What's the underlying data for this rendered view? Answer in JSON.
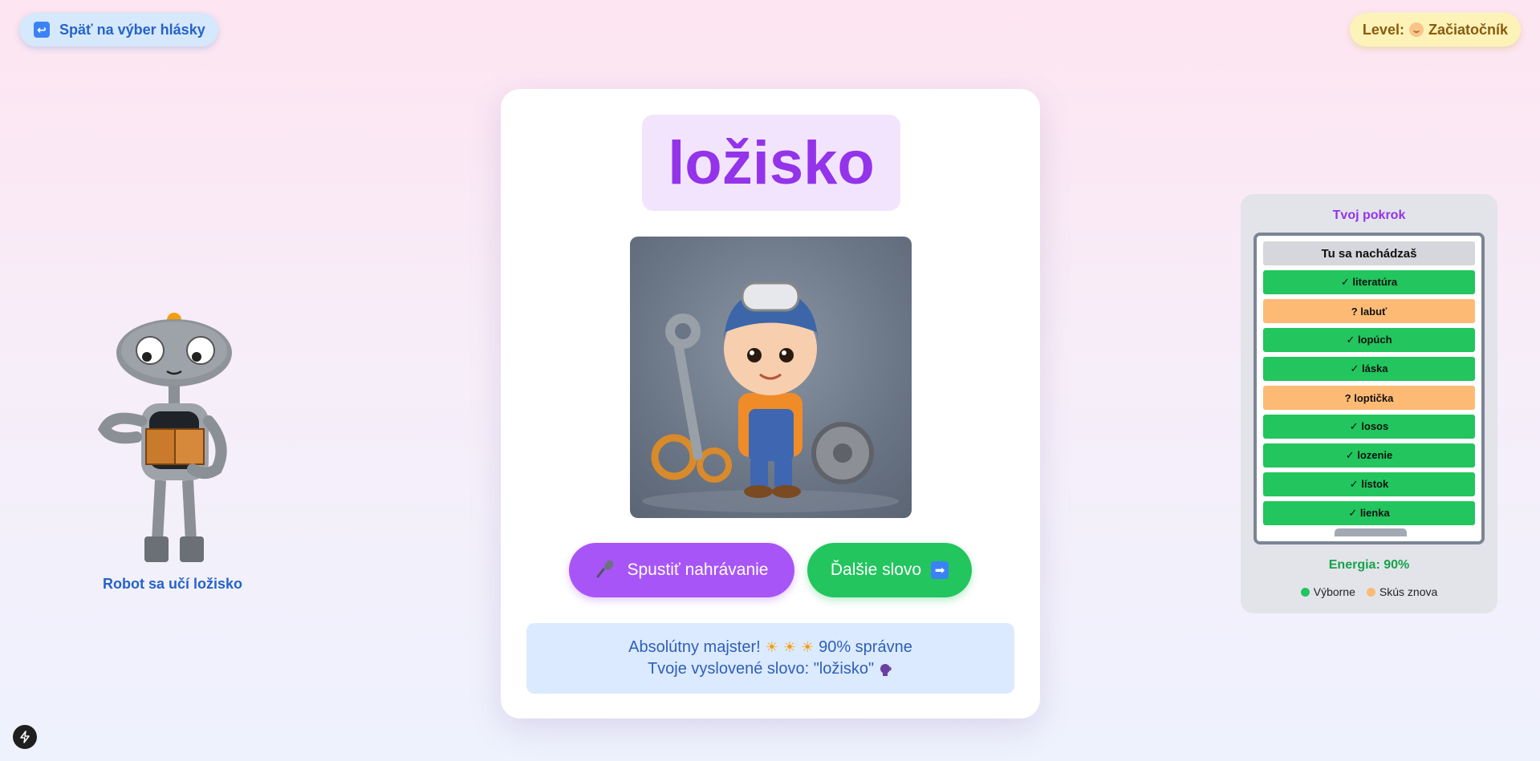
{
  "header": {
    "back_label": "Späť na výber hlásky",
    "level_label": "Level:",
    "level_value": "Začiatočník"
  },
  "robot": {
    "caption": "Robot sa učí ložisko"
  },
  "card": {
    "word": "ložisko",
    "record_label": "Spustiť nahrávanie",
    "next_label": "Ďalšie slovo",
    "feedback_line1_prefix": "Absolútny majster!",
    "feedback_line1_suffix": "90% správne",
    "feedback_line2": "Tvoje vyslovené slovo: \"ložisko\""
  },
  "progress": {
    "title": "Tvoj pokrok",
    "header_row": "Tu sa nachádzaš",
    "items": [
      {
        "label": "✓ literatúra",
        "status": "good"
      },
      {
        "label": "? labuť",
        "status": "retry"
      },
      {
        "label": "✓ lopúch",
        "status": "good"
      },
      {
        "label": "✓ láska",
        "status": "good"
      },
      {
        "label": "? loptička",
        "status": "retry"
      },
      {
        "label": "✓ losos",
        "status": "good"
      },
      {
        "label": "✓ lozenie",
        "status": "good"
      },
      {
        "label": "✓ lístok",
        "status": "good"
      },
      {
        "label": "✓ lienka",
        "status": "good"
      }
    ],
    "energy_label": "Energia: 90%",
    "legend_good": "Výborne",
    "legend_retry": "Skús znova"
  },
  "colors": {
    "accent_purple": "#a855f7",
    "accent_green": "#22c55e",
    "retry_orange": "#fdba74",
    "link_blue": "#2563c9"
  }
}
